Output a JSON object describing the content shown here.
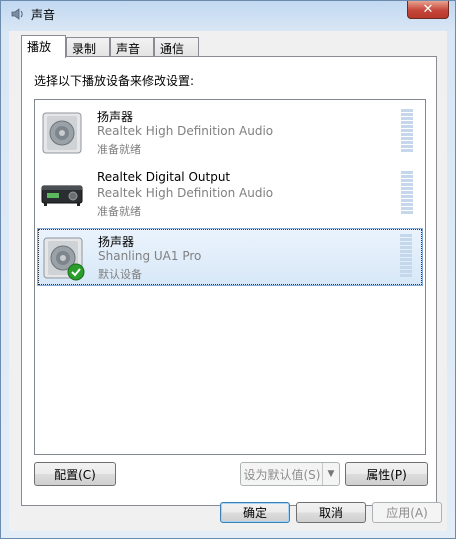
{
  "window": {
    "title": "声音",
    "close_glyph": "✕"
  },
  "tabs": [
    {
      "label": "播放",
      "active": true
    },
    {
      "label": "录制",
      "active": false
    },
    {
      "label": "声音",
      "active": false
    },
    {
      "label": "通信",
      "active": false
    }
  ],
  "instruction": "选择以下播放设备来修改设置:",
  "devices": [
    {
      "name": "扬声器",
      "description": "Realtek High Definition Audio",
      "status": "准备就绪",
      "icon": "speaker-icon",
      "selected": false
    },
    {
      "name": "Realtek Digital Output",
      "description": "Realtek High Definition Audio",
      "status": "准备就绪",
      "icon": "digital-output-icon",
      "selected": false
    },
    {
      "name": "扬声器",
      "description": "Shanling UA1 Pro",
      "status": "默认设备",
      "icon": "speaker-icon",
      "selected": true,
      "badge": "default-check-icon"
    }
  ],
  "buttons": {
    "configure": "配置(C)",
    "set_default": "设为默认值(S)",
    "properties": "属性(P)",
    "ok": "确定",
    "cancel": "取消",
    "apply": "应用(A)"
  },
  "colors": {
    "selection": "#d8e8f8",
    "level_meter": "#c5d7ea",
    "close_button": "#c5463a",
    "check_green": "#2a9d2a"
  }
}
